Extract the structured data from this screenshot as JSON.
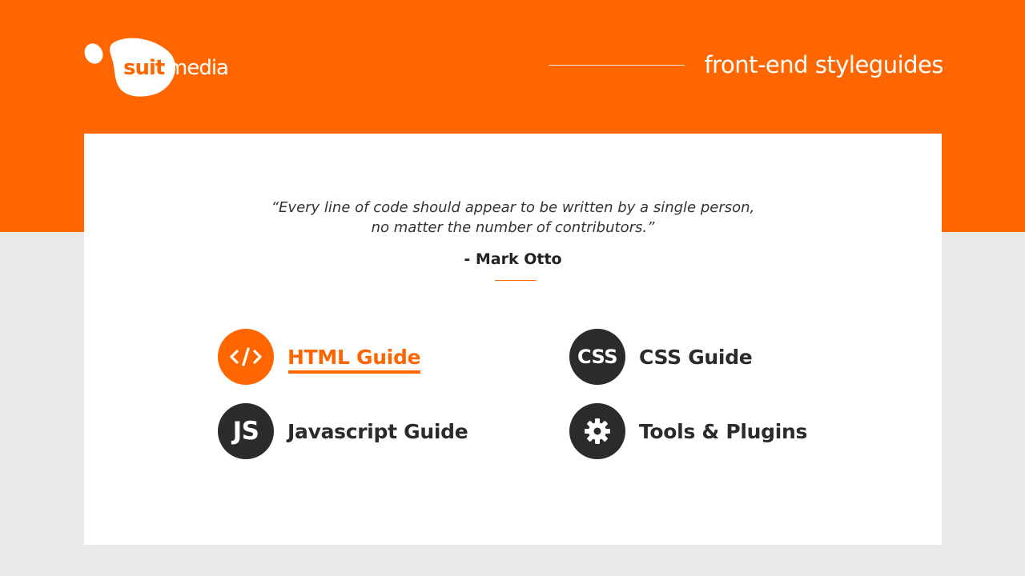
{
  "brand": {
    "logo_text_suit": "suit",
    "logo_text_media": "media",
    "primary_color": "#ff6600",
    "dark_color": "#2b2b2b",
    "background_color": "#eaeaea"
  },
  "header": {
    "title": "front-end styleguides"
  },
  "quote": {
    "line1": "“Every line of code should appear to be written by a single person,",
    "line2": "no matter the number of contributors.”",
    "author": "- Mark Otto"
  },
  "guides": [
    {
      "label": "HTML Guide",
      "icon_text": "</>",
      "icon": "code-icon",
      "active": true
    },
    {
      "label": "CSS Guide",
      "icon_text": "CSS",
      "icon": "css-icon",
      "active": false
    },
    {
      "label": "Javascript Guide",
      "icon_text": "JS",
      "icon": "js-icon",
      "active": false
    },
    {
      "label": "Tools & Plugins",
      "icon_text": "",
      "icon": "gear-icon",
      "active": false
    }
  ]
}
